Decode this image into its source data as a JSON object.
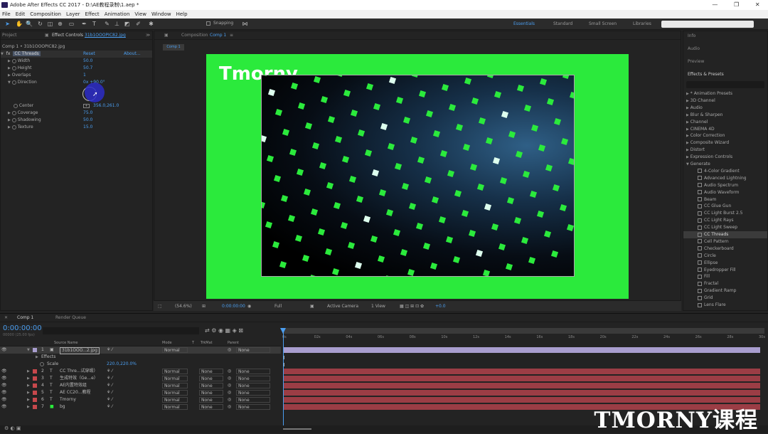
{
  "window": {
    "title": "Adobe After Effects CC 2017 - D:\\AE教程录制\\1.aep *",
    "controls": [
      "—",
      "❐",
      "✕"
    ]
  },
  "menu": [
    "File",
    "Edit",
    "Composition",
    "Layer",
    "Effect",
    "Animation",
    "View",
    "Window",
    "Help"
  ],
  "toolbar": {
    "snapping": "Snapping",
    "workspaces": [
      "Essentials",
      "Standard",
      "Small Screen",
      "Libraries"
    ],
    "active_workspace": "Essentials"
  },
  "left_panel": {
    "tabs": {
      "project": "Project",
      "effect_controls": "Effect Controls",
      "layer_name": "31b1OOOPIC82.jpg"
    },
    "breadcrumb": "Comp 1 • 31b1OOOPIC82.jpg",
    "effect": {
      "name": "CC Threads",
      "reset": "Reset",
      "about": "About..."
    },
    "props": [
      {
        "name": "Width",
        "value": "50.0"
      },
      {
        "name": "Height",
        "value": "50.7"
      },
      {
        "name": "Overlaps",
        "value": "1"
      },
      {
        "name": "Direction",
        "value": "0x +90.0°"
      },
      {
        "name": "Center",
        "value": "356.0,261.0"
      },
      {
        "name": "Coverage",
        "value": "75.0"
      },
      {
        "name": "Shadowing",
        "value": "50.0"
      },
      {
        "name": "Texture",
        "value": "15.0"
      }
    ]
  },
  "composition": {
    "tab": "Composition",
    "comp_name": "Comp 1",
    "subtab": "Comp 1",
    "overlay_text": "Tmorny",
    "footer": {
      "zoom": "(54.6%)",
      "timecode": "0:00:00:00",
      "resolution": "Full",
      "camera": "Active Camera",
      "views": "1 View",
      "exposure": "+0.0"
    }
  },
  "right_panel": {
    "sections": [
      "Info",
      "Audio",
      "Preview"
    ],
    "effects_title": "Effects & Presets",
    "categories": [
      "* Animation Presets",
      "3D Channel",
      "Audio",
      "Blur & Sharpen",
      "Channel",
      "CINEMA 4D",
      "Color Correction",
      "Composite Wizard",
      "Distort",
      "Expression Controls"
    ],
    "open_category": "Generate",
    "items": [
      "4-Color Gradient",
      "Advanced Lightning",
      "Audio Spectrum",
      "Audio Waveform",
      "Beam",
      "CC Glue Gun",
      "CC Light Burst 2.5",
      "CC Light Rays",
      "CC Light Sweep",
      "CC Threads",
      "Cell Pattern",
      "Checkerboard",
      "Circle",
      "Ellipse",
      "Eyedropper Fill",
      "Fill",
      "Fractal",
      "Gradient Ramp",
      "Grid",
      "Lens Flare"
    ],
    "selected": "CC Threads"
  },
  "timeline": {
    "tabs": [
      "Comp 1",
      "Render Queue"
    ],
    "timecode": "0:00:00:00",
    "fps": "00000 (25.00 fps)",
    "columns": {
      "source": "Source Name",
      "mode": "Mode",
      "t": "T",
      "trkmat": "TrkMat",
      "parent": "Parent"
    },
    "ruler": [
      "0s",
      "02s",
      "04s",
      "06s",
      "08s",
      "10s",
      "12s",
      "14s",
      "16s",
      "18s",
      "20s",
      "22s",
      "24s",
      "26s",
      "28s",
      "30s"
    ],
    "layers": [
      {
        "num": "1",
        "type": "img",
        "name": "31b1OOO...2.jpg",
        "mode": "Normal",
        "trk": "",
        "parent": "None",
        "color": "#a99ecf",
        "selected": true
      },
      {
        "num": "",
        "type": "sub",
        "name": "Effects",
        "mode": "",
        "trk": "",
        "parent": "",
        "color": ""
      },
      {
        "num": "",
        "type": "sub2",
        "name": "Scale",
        "value": "220.0,220.0%",
        "mode": "",
        "trk": "",
        "parent": "",
        "color": ""
      },
      {
        "num": "2",
        "type": "T",
        "name": "CC Thre...试穿缎）",
        "mode": "Normal",
        "trk": "None",
        "parent": "None",
        "color": "#c7484c"
      },
      {
        "num": "3",
        "type": "T",
        "name": "生成特效（Ge...e）",
        "mode": "Normal",
        "trk": "None",
        "parent": "None",
        "color": "#c7484c"
      },
      {
        "num": "4",
        "type": "T",
        "name": "AE内置特效组",
        "mode": "Normal",
        "trk": "None",
        "parent": "None",
        "color": "#c7484c"
      },
      {
        "num": "5",
        "type": "T",
        "name": "AE  CC20...教程",
        "mode": "Normal",
        "trk": "None",
        "parent": "None",
        "color": "#c7484c"
      },
      {
        "num": "6",
        "type": "T",
        "name": "Tmorny",
        "mode": "Normal",
        "trk": "None",
        "parent": "None",
        "color": "#c7484c"
      },
      {
        "num": "7",
        "type": "solid",
        "name": "bg",
        "mode": "Normal",
        "trk": "None",
        "parent": "None",
        "color": "#c7484c"
      }
    ]
  },
  "watermark": "TMORNY课程",
  "colors": {
    "accent": "#4b9ef0",
    "green_bg": "#2bea3c",
    "text_layer": "#c7484c",
    "image_layer": "#a99ecf"
  }
}
